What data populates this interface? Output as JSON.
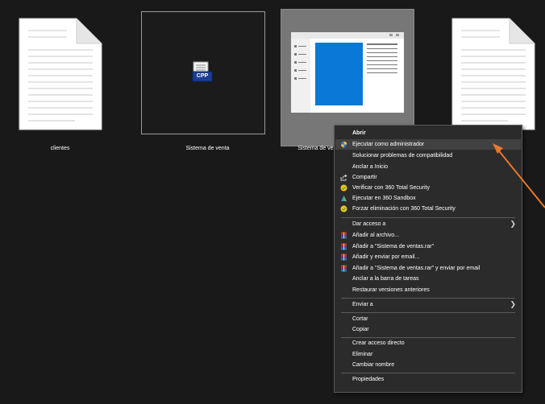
{
  "files": [
    {
      "name": "clientes",
      "type": "document",
      "state": "normal"
    },
    {
      "name": "Sistema de venta",
      "type": "cpp-project",
      "badge": "CPP",
      "state": "outlined"
    },
    {
      "name": "Sistema de ventas",
      "type": "application",
      "state": "selected"
    },
    {
      "name": "",
      "type": "document",
      "state": "normal"
    }
  ],
  "context_menu": {
    "items": [
      {
        "label": "Abrir",
        "bold": true
      },
      {
        "label": "Ejecutar como administrador",
        "icon": "shield-icon",
        "hover": true
      },
      {
        "label": "Solucionar problemas de compatibilidad"
      },
      {
        "label": "Anclar a Inicio"
      },
      {
        "label": "Compartir",
        "icon": "share-icon"
      },
      {
        "label": "Verificar con 360 Total Security",
        "icon": "360-security-icon"
      },
      {
        "label": "Ejecutar en 360 Sandbox",
        "icon": "360-sandbox-icon"
      },
      {
        "label": "Forzar eliminación con 360 Total Security",
        "icon": "360-security-icon"
      },
      {
        "label": "Dar acceso a",
        "submenu": true
      },
      {
        "label": "Añadir al archivo...",
        "icon": "winrar-icon"
      },
      {
        "label": "Añadir a \"Sistema de ventas.rar\"",
        "icon": "winrar-icon"
      },
      {
        "label": "Añadir y enviar por email...",
        "icon": "winrar-icon"
      },
      {
        "label": "Añadir a \"Sistema de ventas.rar\" y enviar por email",
        "icon": "winrar-icon"
      },
      {
        "label": "Anclar a la barra de tareas"
      },
      {
        "label": "Restaurar versiones anteriores"
      },
      {
        "label": "Enviar a",
        "submenu": true
      },
      {
        "label": "Cortar"
      },
      {
        "label": "Copiar"
      },
      {
        "label": "Crear acceso directo"
      },
      {
        "label": "Eliminar"
      },
      {
        "label": "Cambiar nombre"
      },
      {
        "label": "Propiedades"
      }
    ]
  },
  "colors": {
    "background": "#191919",
    "menu_background": "#2b2b2b",
    "menu_hover": "#414141",
    "selected_tile": "#777777",
    "annotation_arrow": "#e8772e",
    "app_window_blue": "#0a78d7"
  }
}
